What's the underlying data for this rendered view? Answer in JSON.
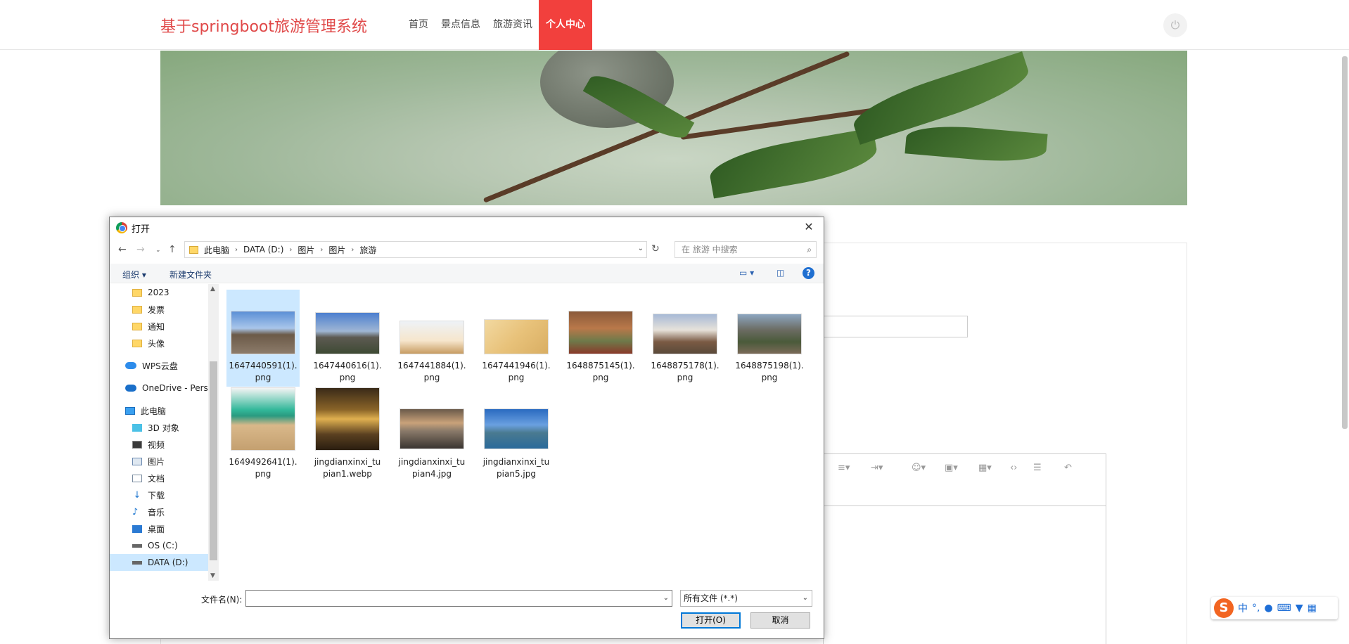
{
  "site": {
    "title": "基于springboot旅游管理系统",
    "nav": [
      "首页",
      "景点信息",
      "旅游资讯",
      "个人中心"
    ],
    "active_nav": "个人中心",
    "power_icon": "power-icon"
  },
  "dialog": {
    "title": "打开",
    "close_label": "✕",
    "address": [
      "此电脑",
      "DATA (D:)",
      "图片",
      "图片",
      "旅游"
    ],
    "search_placeholder": "在 旅游 中搜索",
    "organize_label": "组织 ▾",
    "new_folder_label": "新建文件夹",
    "help_label": "?",
    "sidebar": [
      {
        "label": "2023",
        "icon": "folder-icon"
      },
      {
        "label": "发票",
        "icon": "folder-icon"
      },
      {
        "label": "通知",
        "icon": "folder-icon"
      },
      {
        "label": "头像",
        "icon": "folder-icon"
      },
      {
        "label": "WPS云盘",
        "icon": "cloud-icon"
      },
      {
        "label": "OneDrive - Perso",
        "icon": "onedrive-icon"
      },
      {
        "label": "此电脑",
        "icon": "pc-icon"
      },
      {
        "label": "3D 对象",
        "icon": "cube-icon"
      },
      {
        "label": "视频",
        "icon": "video-icon"
      },
      {
        "label": "图片",
        "icon": "picture-icon"
      },
      {
        "label": "文档",
        "icon": "document-icon"
      },
      {
        "label": "下载",
        "icon": "download-icon"
      },
      {
        "label": "音乐",
        "icon": "music-icon"
      },
      {
        "label": "桌面",
        "icon": "desktop-icon"
      },
      {
        "label": "OS (C:)",
        "icon": "drive-icon"
      },
      {
        "label": "DATA (D:)",
        "icon": "drive-icon"
      }
    ],
    "files": [
      {
        "name": "1647440591(1).\npng"
      },
      {
        "name": "1647440616(1).\npng"
      },
      {
        "name": "1647441884(1).\npng"
      },
      {
        "name": "1647441946(1).\npng"
      },
      {
        "name": "1648875145(1).\npng"
      },
      {
        "name": "1648875178(1).\npng"
      },
      {
        "name": "1648875198(1).\npng"
      },
      {
        "name": "1649492641(1).\npng"
      },
      {
        "name": "jingdianxinxi_tu\npian1.webp"
      },
      {
        "name": "jingdianxinxi_tu\npian4.jpg"
      },
      {
        "name": "jingdianxinxi_tu\npian5.jpg"
      }
    ],
    "filename_label": "文件名(N):",
    "filename_value": "",
    "filetype_value": "所有文件 (*.*)",
    "open_label": "打开(O)",
    "cancel_label": "取消"
  },
  "ime": {
    "logo": "S",
    "mode": "中"
  }
}
